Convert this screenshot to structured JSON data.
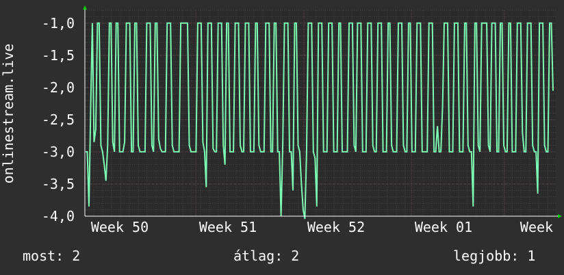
{
  "chart_data": {
    "type": "line",
    "ylabel": "onlinestream.live",
    "xlabel": "",
    "title": "",
    "ylim": [
      -4.0,
      -0.8
    ],
    "yticks": [
      -1.0,
      -1.5,
      -2.0,
      -2.5,
      -3.0,
      -3.5,
      -4.0
    ],
    "ytick_labels": [
      "-1,0",
      "-1,5",
      "-2,0",
      "-2,5",
      "-3,0",
      "-3,5",
      "-4,0"
    ],
    "xtick_labels": [
      "Week 50",
      "Week 51",
      "Week 52",
      "Week 01",
      "Week"
    ],
    "grid": true,
    "colors": {
      "background": "#2e2e2e",
      "plot_bg": "#2b2b2b",
      "line": "#7dfcb4",
      "grid": "#5a4848",
      "axis_arrow": "#00cc00"
    },
    "series": [
      {
        "values": [
          -3.0,
          -3.0,
          -3.85,
          -2.3,
          -1.0,
          -2.85,
          -2.65,
          -1.0,
          -1.0,
          -2.9,
          -3.0,
          -3.2,
          -3.45,
          -2.9,
          -1.0,
          -1.0,
          -2.85,
          -3.0,
          -1.0,
          -1.0,
          -3.0,
          -3.0,
          -3.0,
          -2.85,
          -1.0,
          -1.0,
          -1.0,
          -3.0,
          -3.0,
          -1.0,
          -1.0,
          -2.9,
          -3.0,
          -3.0,
          -3.0,
          -3.0,
          -1.0,
          -1.0,
          -1.0,
          -2.9,
          -3.0,
          -1.0,
          -1.0,
          -2.8,
          -2.95,
          -3.0,
          -3.0,
          -3.0,
          -1.0,
          -1.0,
          -1.0,
          -2.9,
          -3.0,
          -3.0,
          -3.0,
          -3.0,
          -1.0,
          -1.0,
          -1.0,
          -1.0,
          -1.0,
          -2.9,
          -3.0,
          -3.0,
          -3.0,
          -3.0,
          -1.0,
          -1.0,
          -1.0,
          -2.85,
          -3.0,
          -3.55,
          -1.0,
          -1.0,
          -1.0,
          -2.95,
          -3.0,
          -3.0,
          -1.0,
          -1.0,
          -1.0,
          -2.9,
          -3.2,
          -1.0,
          -1.0,
          -3.0,
          -3.0,
          -3.0,
          -1.0,
          -1.0,
          -1.0,
          -2.9,
          -3.0,
          -3.0,
          -1.0,
          -1.0,
          -1.0,
          -3.0,
          -3.0,
          -3.0,
          -1.0,
          -1.0,
          -2.9,
          -3.0,
          -3.0,
          -3.0,
          -1.0,
          -1.0,
          -1.0,
          -3.0,
          -3.0,
          -1.0,
          -1.0,
          -3.0,
          -3.0,
          -4.0,
          -2.9,
          -1.0,
          -1.0,
          -1.0,
          -3.0,
          -3.0,
          -3.6,
          -1.0,
          -1.0,
          -2.9,
          -3.0,
          -3.5,
          -3.9,
          -4.1,
          -3.0,
          -1.0,
          -1.0,
          -1.0,
          -3.0,
          -3.1,
          -3.85,
          -1.0,
          -1.0,
          -1.0,
          -3.0,
          -3.0,
          -3.0,
          -1.0,
          -1.0,
          -1.0,
          -3.0,
          -3.0,
          -3.0,
          -1.0,
          -1.0,
          -3.0,
          -3.0,
          -3.0,
          -3.0,
          -1.0,
          -1.0,
          -1.0,
          -2.9,
          -3.0,
          -1.0,
          -1.0,
          -1.0,
          -3.0,
          -3.0,
          -3.0,
          -1.0,
          -1.0,
          -1.0,
          -2.9,
          -3.0,
          -3.0,
          -1.0,
          -1.0,
          -1.0,
          -3.0,
          -3.0,
          -3.0,
          -1.0,
          -1.0,
          -2.9,
          -3.0,
          -3.0,
          -3.0,
          -1.0,
          -1.0,
          -1.0,
          -2.9,
          -3.0,
          -3.0,
          -1.0,
          -1.0,
          -3.0,
          -3.0,
          -3.0,
          -1.0,
          -1.0,
          -1.0,
          -3.0,
          -3.0,
          -3.0,
          -3.0,
          -1.0,
          -1.0,
          -1.0,
          -3.0,
          -3.0,
          -2.6,
          -3.0,
          -3.0,
          -2.3,
          -1.0,
          -1.0,
          -1.0,
          -3.0,
          -3.0,
          -3.0,
          -1.0,
          -1.0,
          -1.0,
          -3.0,
          -3.0,
          -3.0,
          -1.0,
          -1.0,
          -2.9,
          -3.0,
          -3.0,
          -3.85,
          -1.0,
          -1.0,
          -2.9,
          -3.0,
          -1.0,
          -1.0,
          -1.0,
          -1.0,
          -2.9,
          -3.0,
          -1.0,
          -1.0,
          -1.0,
          -3.0,
          -3.0,
          -1.0,
          -1.0,
          -2.9,
          -3.0,
          -3.0,
          -1.0,
          -1.0,
          -3.0,
          -3.0,
          -3.0,
          -1.0,
          -1.0,
          -1.0,
          -2.7,
          -3.0,
          -3.0,
          -1.0,
          -1.0,
          -1.0,
          -2.9,
          -3.0,
          -3.0,
          -3.65,
          -1.0,
          -1.0,
          -1.0,
          -2.9,
          -3.0,
          -3.0,
          -1.0,
          -1.0,
          -2.05
        ]
      }
    ]
  },
  "stats": {
    "current": "most: 2",
    "average": "átlag: 2",
    "best": "legjobb: 1"
  }
}
